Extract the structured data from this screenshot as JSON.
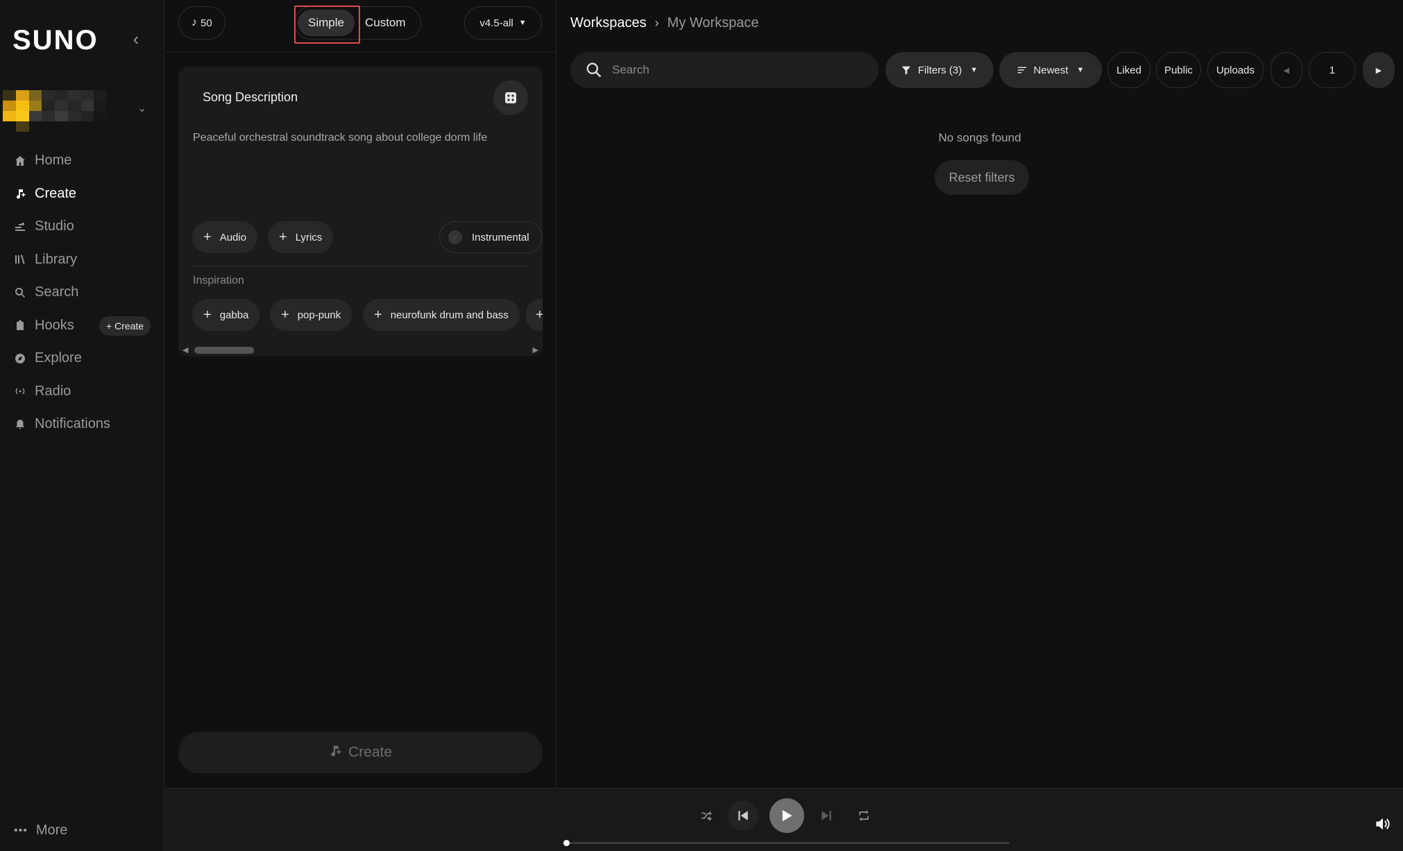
{
  "app": {
    "logo": "SUNO"
  },
  "sidebar": {
    "nav": [
      {
        "label": "Home",
        "icon": "home-icon"
      },
      {
        "label": "Create",
        "icon": "create-icon",
        "active": true
      },
      {
        "label": "Studio",
        "icon": "studio-icon"
      },
      {
        "label": "Library",
        "icon": "library-icon"
      },
      {
        "label": "Search",
        "icon": "search-icon"
      },
      {
        "label": "Hooks",
        "icon": "hooks-icon"
      },
      {
        "label": "Explore",
        "icon": "explore-icon"
      },
      {
        "label": "Radio",
        "icon": "radio-icon"
      },
      {
        "label": "Notifications",
        "icon": "bell-icon"
      }
    ],
    "hooks_create_label": "+ Create",
    "more_label": "More"
  },
  "create_panel": {
    "credits": "50",
    "modes": {
      "simple": "Simple",
      "custom": "Custom",
      "selected": "Simple"
    },
    "model": "v4.5-all",
    "song_description_title": "Song Description",
    "description_text": "Peaceful orchestral soundtrack song about college dorm life",
    "add_audio": "Audio",
    "add_lyrics": "Lyrics",
    "instrumental": "Instrumental",
    "inspiration_label": "Inspiration",
    "inspiration_tags": [
      "gabba",
      "pop-punk",
      "neurofunk drum and bass"
    ],
    "create_button": "Create"
  },
  "workspace": {
    "breadcrumb_root": "Workspaces",
    "breadcrumb_current": "My Workspace",
    "search_placeholder": "Search",
    "filters_label": "Filters (3)",
    "sort_label": "Newest",
    "liked": "Liked",
    "public": "Public",
    "uploads": "Uploads",
    "page": "1",
    "empty_message": "No songs found",
    "reset_filters": "Reset filters"
  },
  "player": {
    "progress": 0
  },
  "colors": {
    "background": "#101012",
    "sidebar": "#141416",
    "card": "#1b1b1d",
    "chip": "#28282a",
    "highlight": "#e34948"
  }
}
